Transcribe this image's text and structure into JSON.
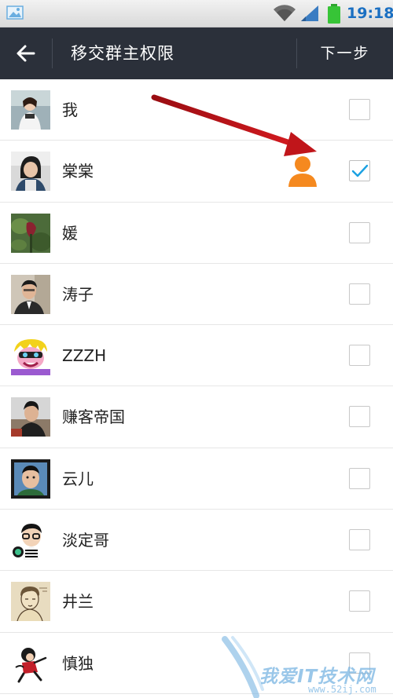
{
  "status_bar": {
    "time": "19:18",
    "icons": [
      "gallery-icon",
      "wifi-icon",
      "signal-icon",
      "battery-icon"
    ],
    "time_color": "#1a6fc2"
  },
  "header": {
    "back_icon": "arrow-left-icon",
    "title": "移交群主权限",
    "next_label": "下一步",
    "background": "#2b303a"
  },
  "members": [
    {
      "name": "我",
      "checked": false
    },
    {
      "name": "棠棠",
      "checked": true,
      "badge_icon": "person-owner-icon"
    },
    {
      "name": "媛",
      "checked": false
    },
    {
      "name": "涛子",
      "checked": false
    },
    {
      "name": "ZZZH",
      "checked": false
    },
    {
      "name": "赚客帝国",
      "checked": false
    },
    {
      "name": "云儿",
      "checked": false
    },
    {
      "name": "淡定哥",
      "checked": false
    },
    {
      "name": "井兰",
      "checked": false
    },
    {
      "name": "慎独",
      "checked": false
    }
  ],
  "colors": {
    "check_accent": "#1ba1e2",
    "owner_badge": "#f5891f",
    "annotation_arrow": "#c0151a"
  },
  "watermark": {
    "text": "我爱IT技术网",
    "url": "www.52ij.com"
  }
}
